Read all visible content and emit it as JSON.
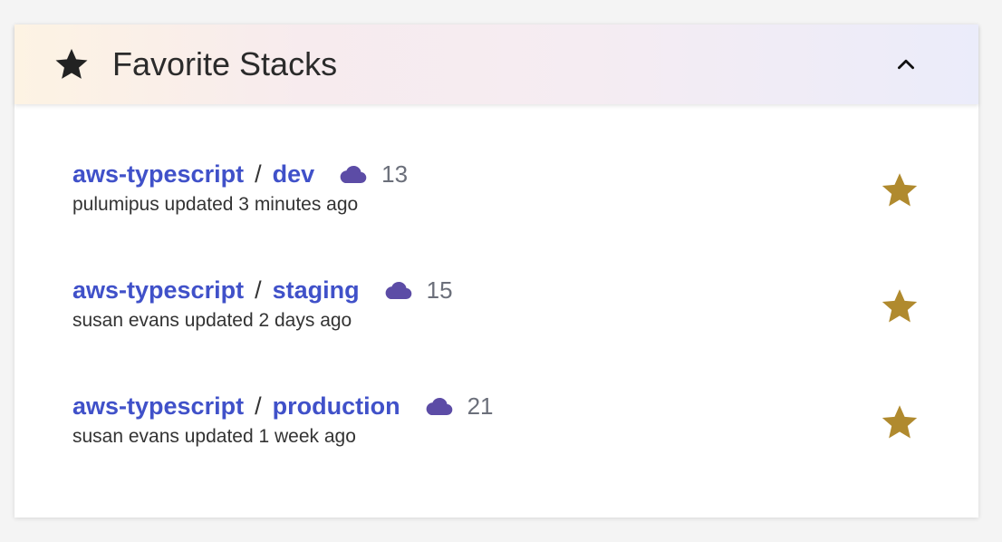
{
  "header": {
    "title": "Favorite Stacks",
    "icon": "star-icon",
    "collapse_icon": "chevron-up-icon"
  },
  "stacks": [
    {
      "project": "aws-typescript",
      "separator": "/",
      "stack": "dev",
      "resource_count": "13",
      "updated": "pulumipus updated 3 minutes ago"
    },
    {
      "project": "aws-typescript",
      "separator": "/",
      "stack": "staging",
      "resource_count": "15",
      "updated": "susan evans updated 2 days ago"
    },
    {
      "project": "aws-typescript",
      "separator": "/",
      "stack": "production",
      "resource_count": "21",
      "updated": "susan evans updated 1 week ago"
    }
  ],
  "colors": {
    "link": "#4051c9",
    "cloud": "#5c4ca6",
    "favorite_star": "#b08a2e",
    "title": "#2b2b2b"
  }
}
